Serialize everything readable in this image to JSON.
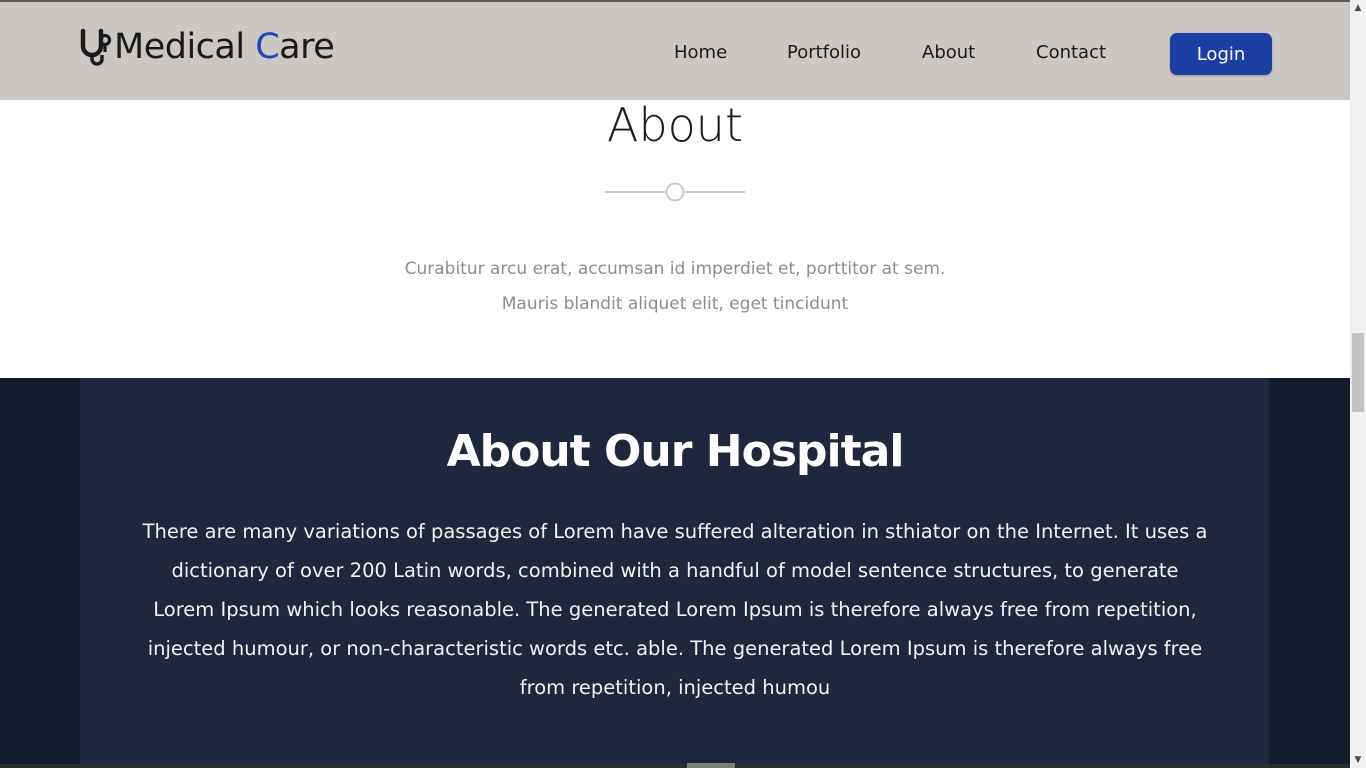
{
  "header": {
    "brand_prefix": "Medical ",
    "brand_accent": "C",
    "brand_suffix": "are",
    "accent_color": "#1e46b4",
    "logo_icon": "stethoscope-icon",
    "nav": {
      "home": "Home",
      "portfolio": "Portfolio",
      "about": "About",
      "contact": "Contact"
    },
    "login_label": "Login",
    "login_color": "#1b3fa3"
  },
  "about": {
    "title": "About",
    "intro_line1": "Curabitur arcu erat, accumsan id imperdiet et, porttitor at sem.",
    "intro_line2": "Mauris blandit aliquet elit, eget tincidunt"
  },
  "hospital": {
    "title": "About Our Hospital",
    "text": "There are many variations of passages of Lorem have suffered alteration in sthiator on the Internet. It uses a dictionary of over 200 Latin words, combined with a handful of model sentence structures, to generate Lorem Ipsum which looks reasonable. The generated Lorem Ipsum is therefore always free from repetition, injected humour, or non-characteristic words etc. able. The generated Lorem Ipsum is therefore always free from repetition, injected humou",
    "panel_color": "#1f273c"
  }
}
